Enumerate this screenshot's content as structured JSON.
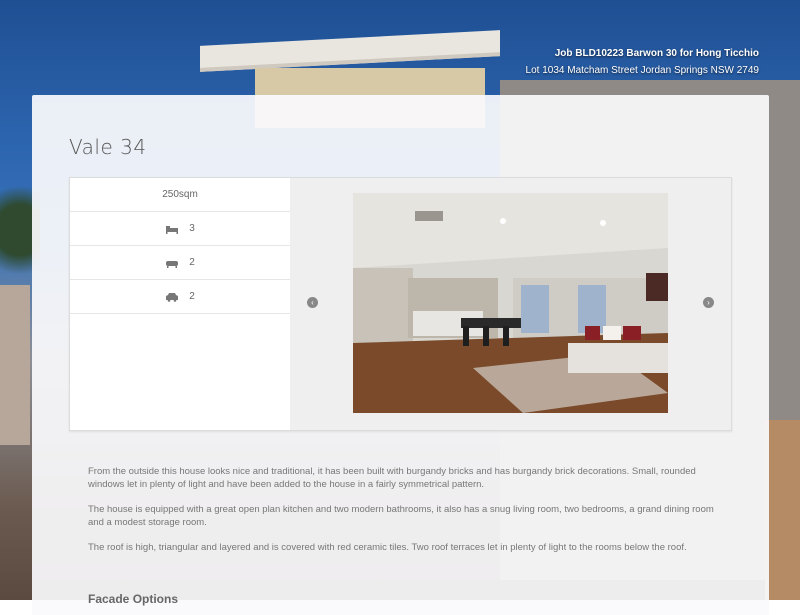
{
  "header": {
    "job": "Job BLD10223 Barwon 30 for Hong Ticchio",
    "address": "Lot 1034 Matcham Street Jordan Springs NSW 2749"
  },
  "listing": {
    "title": "Vale 34",
    "specs": [
      {
        "icon": "area",
        "value": "250sqm"
      },
      {
        "icon": "bed-icon",
        "value": "3"
      },
      {
        "icon": "bath-icon",
        "value": "2"
      },
      {
        "icon": "car-icon",
        "value": "2"
      }
    ]
  },
  "gallery": {
    "prev_label": "‹",
    "next_label": "›"
  },
  "description": {
    "paragraphs": [
      "From the outside this house looks nice and traditional, it has been built with burgandy bricks and has burgandy brick decorations. Small, rounded windows let in plenty of light and have been added to the house in a fairly symmetrical pattern.",
      "The house is equipped with a great open plan kitchen and two modern bathrooms, it also has a snug living room, two bedrooms, a grand dining room and a modest storage room.",
      "The roof is high, triangular and layered and is covered with red ceramic tiles. Two roof terraces let in plenty of light to the rooms below the roof."
    ]
  },
  "facade": {
    "heading": "Facade Options"
  }
}
